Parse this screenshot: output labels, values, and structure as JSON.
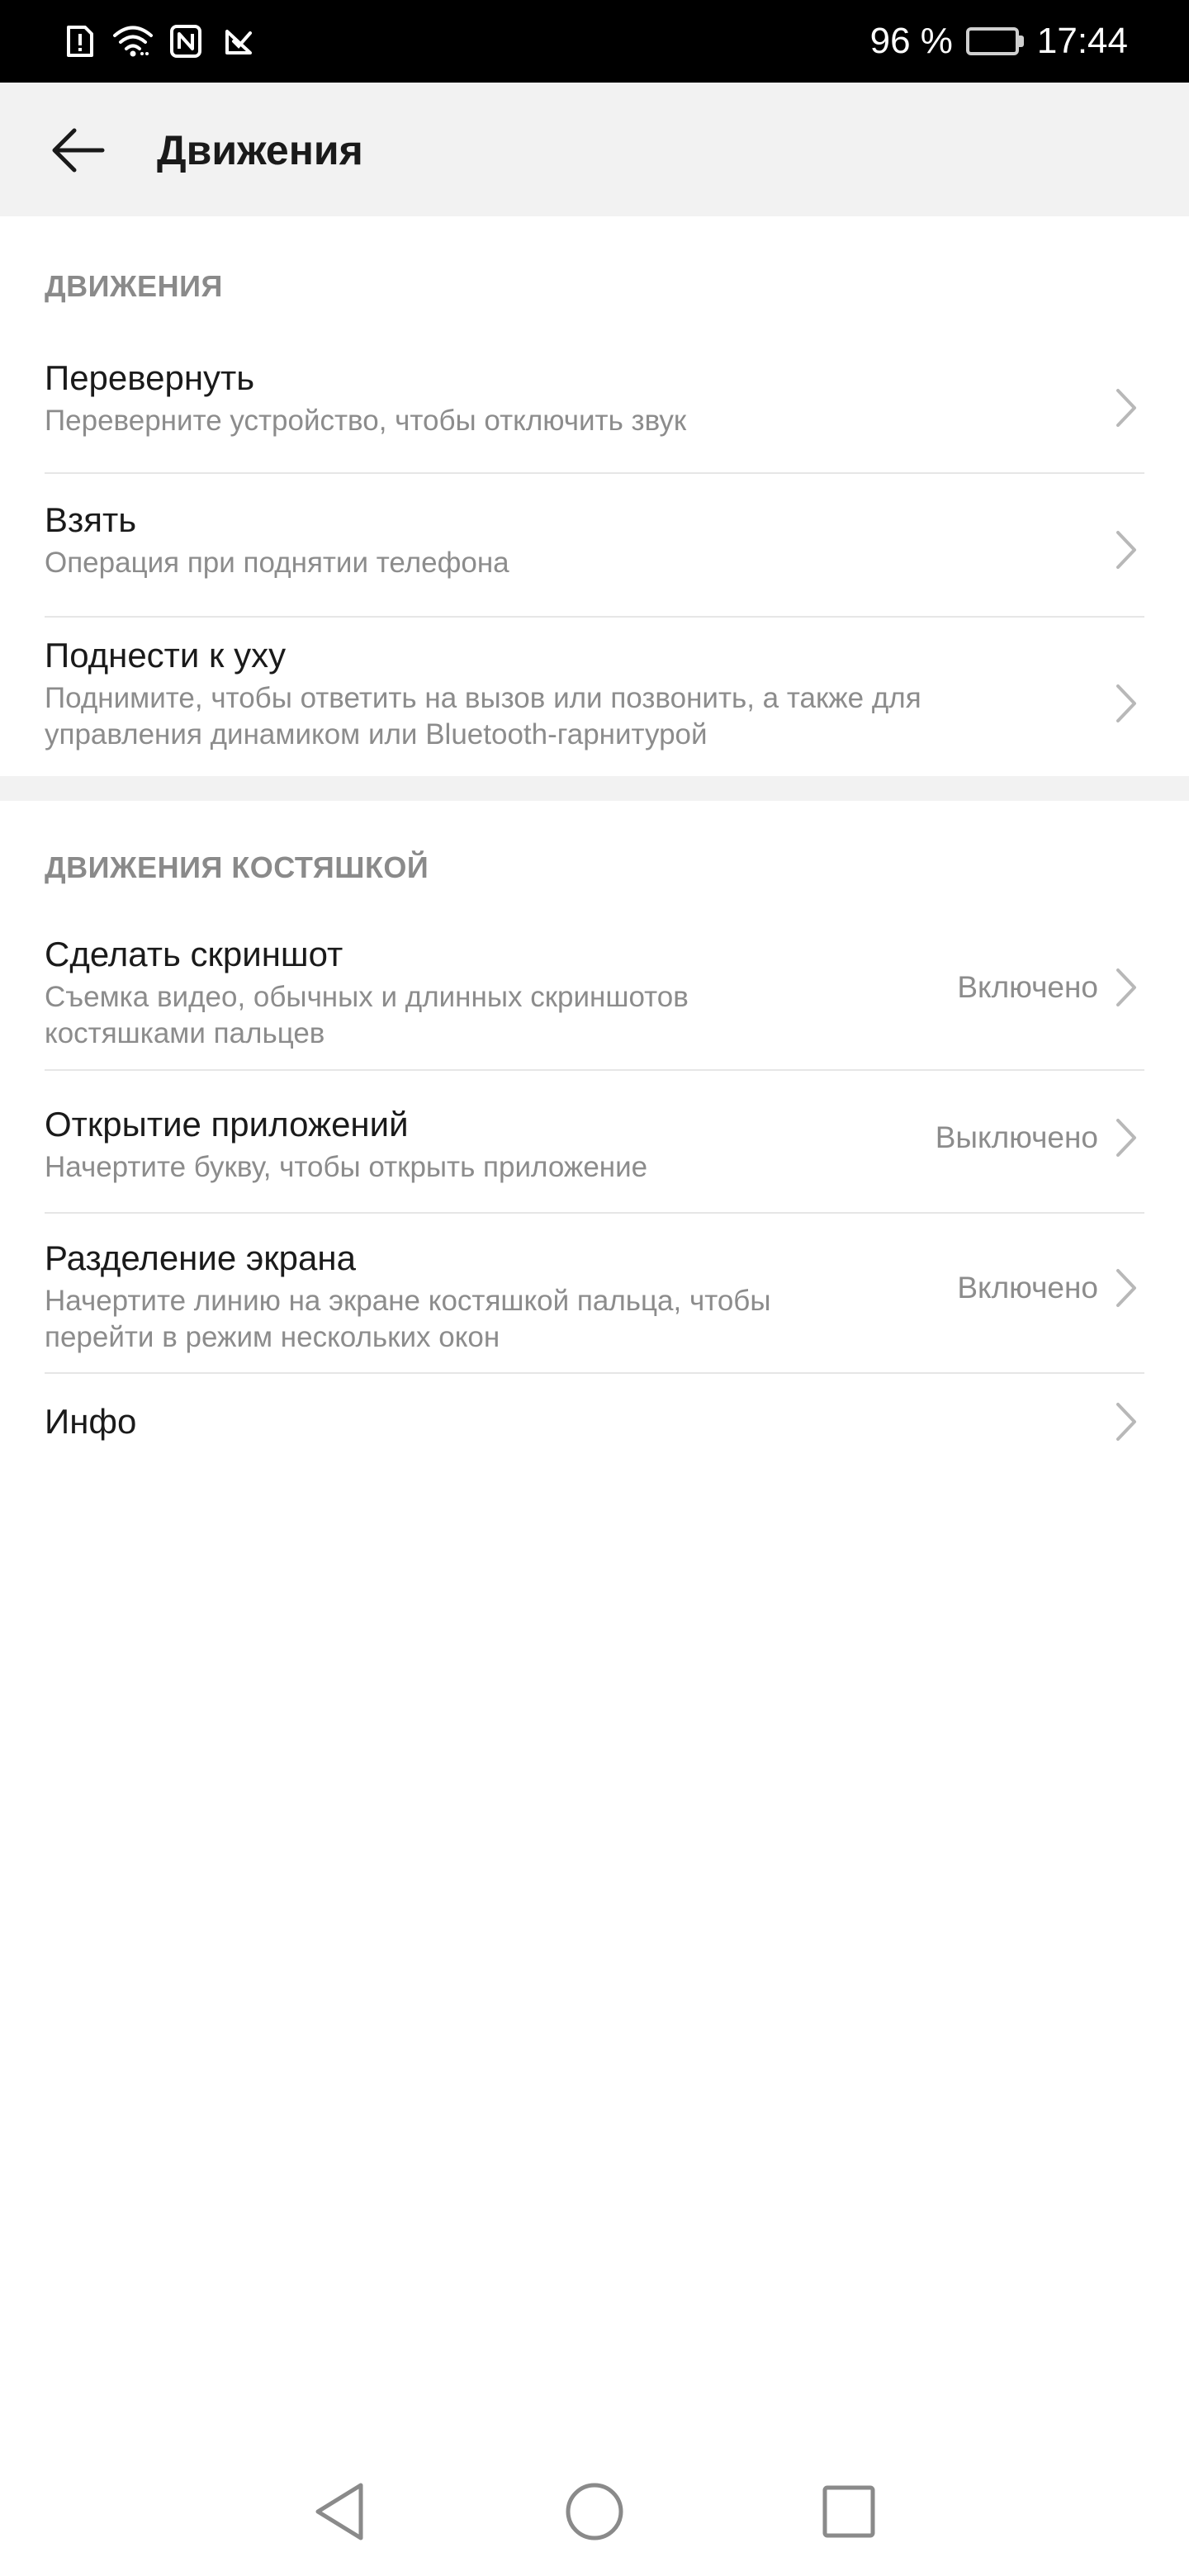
{
  "status_bar": {
    "icons": [
      "alert-sim-icon",
      "wifi-icon",
      "nfc-icon",
      "signal-check-icon"
    ],
    "battery_text": "96 %",
    "battery_level": 0.96,
    "time": "17:44"
  },
  "app_bar": {
    "back_icon": "arrow-left-icon",
    "title": "Движения"
  },
  "section1": {
    "header": "ДВИЖЕНИЯ",
    "items": [
      {
        "title": "Перевернуть",
        "subtitle": "Переверните устройство, чтобы отключить звук"
      },
      {
        "title": "Взять",
        "subtitle": "Операция при поднятии телефона"
      },
      {
        "title": "Поднести к уху",
        "subtitle": "Поднимите, чтобы ответить на вызов или позвонить, а также для управления динамиком или Bluetooth-гарнитурой"
      }
    ]
  },
  "section2": {
    "header": "ДВИЖЕНИЯ КОСТЯШКОЙ",
    "items": [
      {
        "title": "Сделать скриншот",
        "subtitle": "Съемка видео, обычных и длинных скриншотов костяшками пальцев",
        "value": "Включено"
      },
      {
        "title": "Открытие приложений",
        "subtitle": "Начертите букву, чтобы открыть приложение",
        "value": "Выключено"
      },
      {
        "title": "Разделение экрана",
        "subtitle": "Начертите линию на экране костяшкой пальца, чтобы перейти в режим нескольких окон",
        "value": "Включено"
      },
      {
        "title": "Инфо"
      }
    ]
  },
  "nav_bar": {
    "icons": [
      "nav-back-icon",
      "nav-home-icon",
      "nav-recents-icon"
    ]
  },
  "colors": {
    "status_bar_bg": "#000000",
    "app_bar_bg": "#f2f2f2",
    "secondary_text": "#8c8c8c",
    "divider": "#e6e6e6"
  }
}
